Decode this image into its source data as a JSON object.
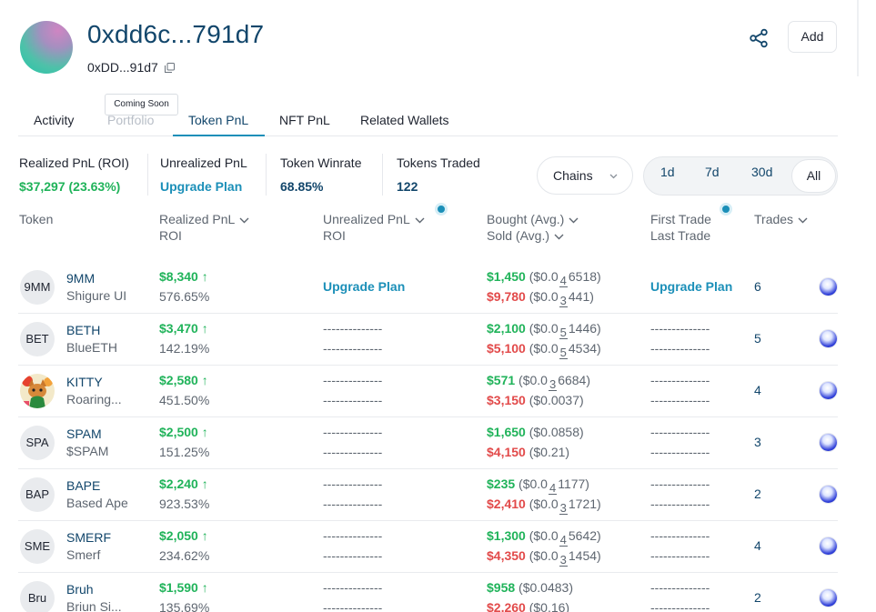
{
  "header": {
    "title": "0xdd6c...791d7",
    "short_address": "0xDD...91d7",
    "add_label": "Add"
  },
  "tabs": [
    {
      "label": "Activity"
    },
    {
      "label": "Portfolio",
      "tooltip": "Coming Soon"
    },
    {
      "label": "Token PnL"
    },
    {
      "label": "NFT PnL"
    },
    {
      "label": "Related Wallets"
    }
  ],
  "stats": {
    "realized": {
      "label": "Realized PnL (ROI)",
      "value": "$37,297 (23.63%)"
    },
    "unrealized": {
      "label": "Unrealized PnL",
      "value": "Upgrade Plan"
    },
    "winrate": {
      "label": "Token Winrate",
      "value": "68.85%"
    },
    "traded": {
      "label": "Tokens Traded",
      "value": "122"
    }
  },
  "filters": {
    "chains_label": "Chains",
    "ranges": [
      "1d",
      "7d",
      "30d",
      "All"
    ],
    "active_range": "All"
  },
  "table": {
    "headers": {
      "token": "Token",
      "realized": "Realized PnL",
      "realized_sub": "ROI",
      "unrealized": "Unrealized PnL",
      "unrealized_sub": "ROI",
      "bought": "Bought (Avg.)",
      "sold": "Sold (Avg.)",
      "first_trade": "First Trade",
      "last_trade": "Last Trade",
      "trades": "Trades"
    },
    "rows": [
      {
        "icon": "9MM",
        "symbol": "9MM",
        "name": "Shigure UI",
        "pnl": "$8,340",
        "roi": "576.65%",
        "unrealized": "Upgrade Plan",
        "unrealized_roi": "",
        "bought": "$1,450",
        "bought_avg": [
          "($0.0",
          "4",
          "6518)"
        ],
        "sold": "$9,780",
        "sold_avg": [
          "($0.0",
          "3",
          "441)"
        ],
        "first": "Upgrade Plan",
        "last": "",
        "trades": "6"
      },
      {
        "icon": "BET",
        "symbol": "BETH",
        "name": "BlueETH",
        "pnl": "$3,470",
        "roi": "142.19%",
        "unrealized": "--------------",
        "unrealized_roi": "--------------",
        "bought": "$2,100",
        "bought_avg": [
          "($0.0",
          "5",
          "1446)"
        ],
        "sold": "$5,100",
        "sold_avg": [
          "($0.0",
          "5",
          "4534)"
        ],
        "first": "--------------",
        "last": "--------------",
        "trades": "5"
      },
      {
        "icon": "",
        "symbol": "KITTY",
        "name": "Roaring...",
        "pnl": "$2,580",
        "roi": "451.50%",
        "unrealized": "--------------",
        "unrealized_roi": "--------------",
        "bought": "$571",
        "bought_avg": [
          "($0.0",
          "3",
          "6684)"
        ],
        "sold": "$3,150",
        "sold_avg": [
          "($0.0037)",
          "",
          ""
        ],
        "first": "--------------",
        "last": "--------------",
        "trades": "4"
      },
      {
        "icon": "SPA",
        "symbol": "SPAM",
        "name": "$SPAM",
        "pnl": "$2,500",
        "roi": "151.25%",
        "unrealized": "--------------",
        "unrealized_roi": "--------------",
        "bought": "$1,650",
        "bought_avg": [
          "($0.0858)",
          "",
          ""
        ],
        "sold": "$4,150",
        "sold_avg": [
          "($0.21)",
          "",
          ""
        ],
        "first": "--------------",
        "last": "--------------",
        "trades": "3"
      },
      {
        "icon": "BAP",
        "symbol": "BAPE",
        "name": "Based Ape",
        "pnl": "$2,240",
        "roi": "923.53%",
        "unrealized": "--------------",
        "unrealized_roi": "--------------",
        "bought": "$235",
        "bought_avg": [
          "($0.0",
          "4",
          "1177)"
        ],
        "sold": "$2,410",
        "sold_avg": [
          "($0.0",
          "3",
          "1721)"
        ],
        "first": "--------------",
        "last": "--------------",
        "trades": "2"
      },
      {
        "icon": "SME",
        "symbol": "SMERF",
        "name": "Smerf",
        "pnl": "$2,050",
        "roi": "234.62%",
        "unrealized": "--------------",
        "unrealized_roi": "--------------",
        "bought": "$1,300",
        "bought_avg": [
          "($0.0",
          "4",
          "5642)"
        ],
        "sold": "$4,350",
        "sold_avg": [
          "($0.0",
          "3",
          "1454)"
        ],
        "first": "--------------",
        "last": "--------------",
        "trades": "4"
      },
      {
        "icon": "Bru",
        "symbol": "Bruh",
        "name": "Briun Si...",
        "pnl": "$1,590",
        "roi": "135.69%",
        "unrealized": "--------------",
        "unrealized_roi": "--------------",
        "bought": "$958",
        "bought_avg": [
          "($0.0483)",
          "",
          ""
        ],
        "sold": "$2,260",
        "sold_avg": [
          "($0.16)",
          "",
          ""
        ],
        "first": "--------------",
        "last": "--------------",
        "trades": "2"
      }
    ]
  },
  "icons": {
    "copy": "copy-icon",
    "share": "share-icon",
    "chevron": "chevron-down-icon",
    "arrow_up": "arrow-up-icon",
    "chain": "ethereum-chain-icon"
  },
  "colors": {
    "brand_navy": "#12466b",
    "accent_teal": "#1b8fb8",
    "profit_green": "#20b35a",
    "sold_red": "#e24a4a"
  }
}
